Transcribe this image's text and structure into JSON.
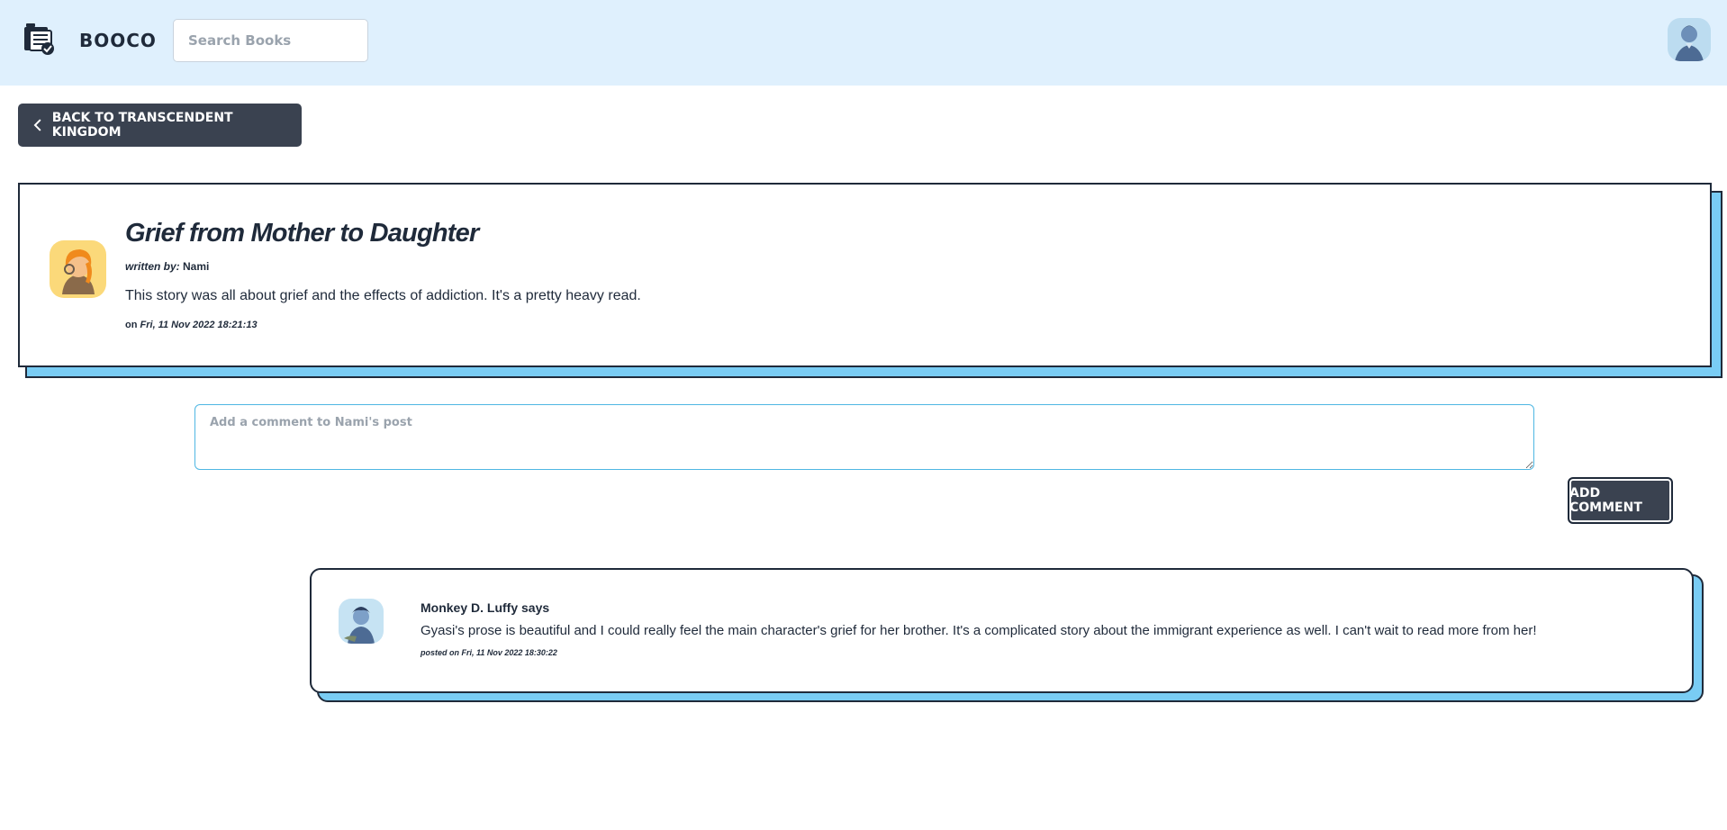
{
  "header": {
    "brand": "BOOCO",
    "logo_icon": "book-stack-icon",
    "search_placeholder": "Search Books",
    "user_avatar_icon": "user-avatar-icon"
  },
  "back_button": {
    "label": "BACK TO TRANSCENDENT KINGDOM",
    "icon": "chevron-left-icon"
  },
  "post": {
    "title": "Grief from Mother to Daughter",
    "written_by_label": "written by:",
    "author": "Nami",
    "body": "This story was all about grief and the effects of addiction. It's a pretty heavy read.",
    "date_prefix": "on",
    "date": "Fri, 11 Nov 2022 18:21:13",
    "avatar_icon": "author-avatar-icon"
  },
  "comment_form": {
    "placeholder": "Add a comment to Nami's post",
    "button_label": "ADD COMMENT"
  },
  "comments": [
    {
      "author_line": "Monkey D. Luffy says",
      "body": "Gyasi's prose is beautiful and I could really feel the main character's grief for her brother. It's a complicated story about the immigrant experience as well. I can't wait to read more from her!",
      "date_line": "posted on Fri, 11 Nov 2022 18:30:22",
      "avatar_icon": "commenter-avatar-icon"
    }
  ],
  "colors": {
    "header_bg": "#dff0fd",
    "button_bg": "#3a4250",
    "card_shadow": "#79ccf4",
    "card_border": "#1f2a3a",
    "input_border": "#4fb7e3"
  }
}
